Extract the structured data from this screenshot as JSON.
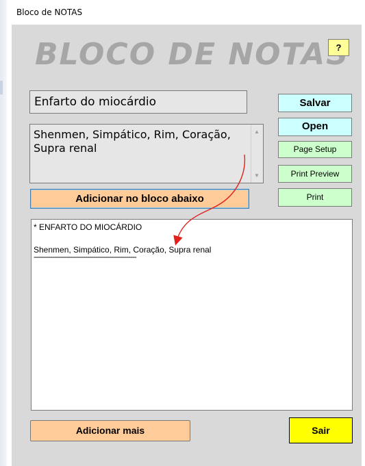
{
  "window": {
    "title": "Bloco de NOTAS"
  },
  "header": {
    "app_title": "BLOCO DE NOTAS",
    "help_label": "?"
  },
  "form": {
    "title_value": "Enfarto do miocárdio",
    "memo_value": "Shenmen, Simpático, Rim, Coração, Supra renal"
  },
  "side_buttons": {
    "salvar": "Salvar",
    "open": "Open",
    "page_setup": "Page Setup",
    "print_preview": "Print Preview",
    "print": "Print"
  },
  "actions": {
    "adicionar_bloco": "Adicionar no bloco abaixo",
    "adicionar_mais": "Adicionar mais",
    "sair": "Sair"
  },
  "notes": {
    "lines": [
      "* ENFARTO DO MIOCÁRDIO",
      "Shenmen, Simpático, Rim, Coração, Supra renal",
      "--------------------------------------------------"
    ]
  },
  "colors": {
    "client_bg": "#d9d9d9",
    "cyan_button": "#ccffff",
    "green_button": "#ccffcc",
    "orange_button": "#ffcc99",
    "yellow_button": "#ffff00",
    "help_button": "#ffff99",
    "annotation_arrow": "#e0201b"
  }
}
